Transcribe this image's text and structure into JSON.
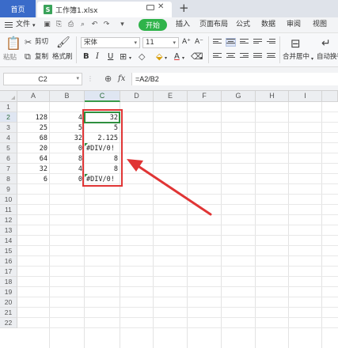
{
  "tabs": {
    "home_label": "首页",
    "file_name": "工作簿1.xlsx",
    "file_icon_letter": "S",
    "new_tab": "+"
  },
  "menu": {
    "file_label": "文件",
    "start_label": "开始",
    "items": [
      "插入",
      "页面布局",
      "公式",
      "数据",
      "审阅",
      "视图"
    ]
  },
  "ribbon": {
    "paste": "粘贴",
    "cut": "剪切",
    "copy": "复制",
    "format_painter": "格式刷",
    "font_name": "宋体",
    "font_size": "11",
    "bold": "B",
    "italic": "I",
    "underline": "U",
    "increase_font": "A⁺",
    "decrease_font": "A⁻",
    "merge_center": "合并居中",
    "wrap_text": "自动换行"
  },
  "formula_bar": {
    "cell_ref": "C2",
    "fx": "fx",
    "formula": "=A2/B2"
  },
  "sheet": {
    "columns": [
      "A",
      "B",
      "C",
      "D",
      "E",
      "F",
      "G",
      "H",
      "I"
    ],
    "selected_column": "C",
    "rows": [
      "1",
      "2",
      "3",
      "4",
      "5",
      "6",
      "7",
      "8",
      "9",
      "10",
      "11",
      "12",
      "13",
      "14",
      "15",
      "16",
      "17",
      "18",
      "19",
      "20",
      "21",
      "22"
    ],
    "selected_row": "2",
    "active_cell": "C2",
    "col_a": [
      "128",
      "25",
      "68",
      "20",
      "64",
      "32",
      "6"
    ],
    "col_b": [
      "4",
      "5",
      "32",
      "0",
      "8",
      "4",
      "0"
    ],
    "col_c": [
      "32",
      "5",
      "2.125",
      "#DIV/0!",
      "8",
      "8",
      "#DIV/0!"
    ]
  },
  "colors": {
    "accent_green": "#2fb34a",
    "home_tab_blue": "#3a6bc9",
    "annotation_red": "#e03535"
  }
}
